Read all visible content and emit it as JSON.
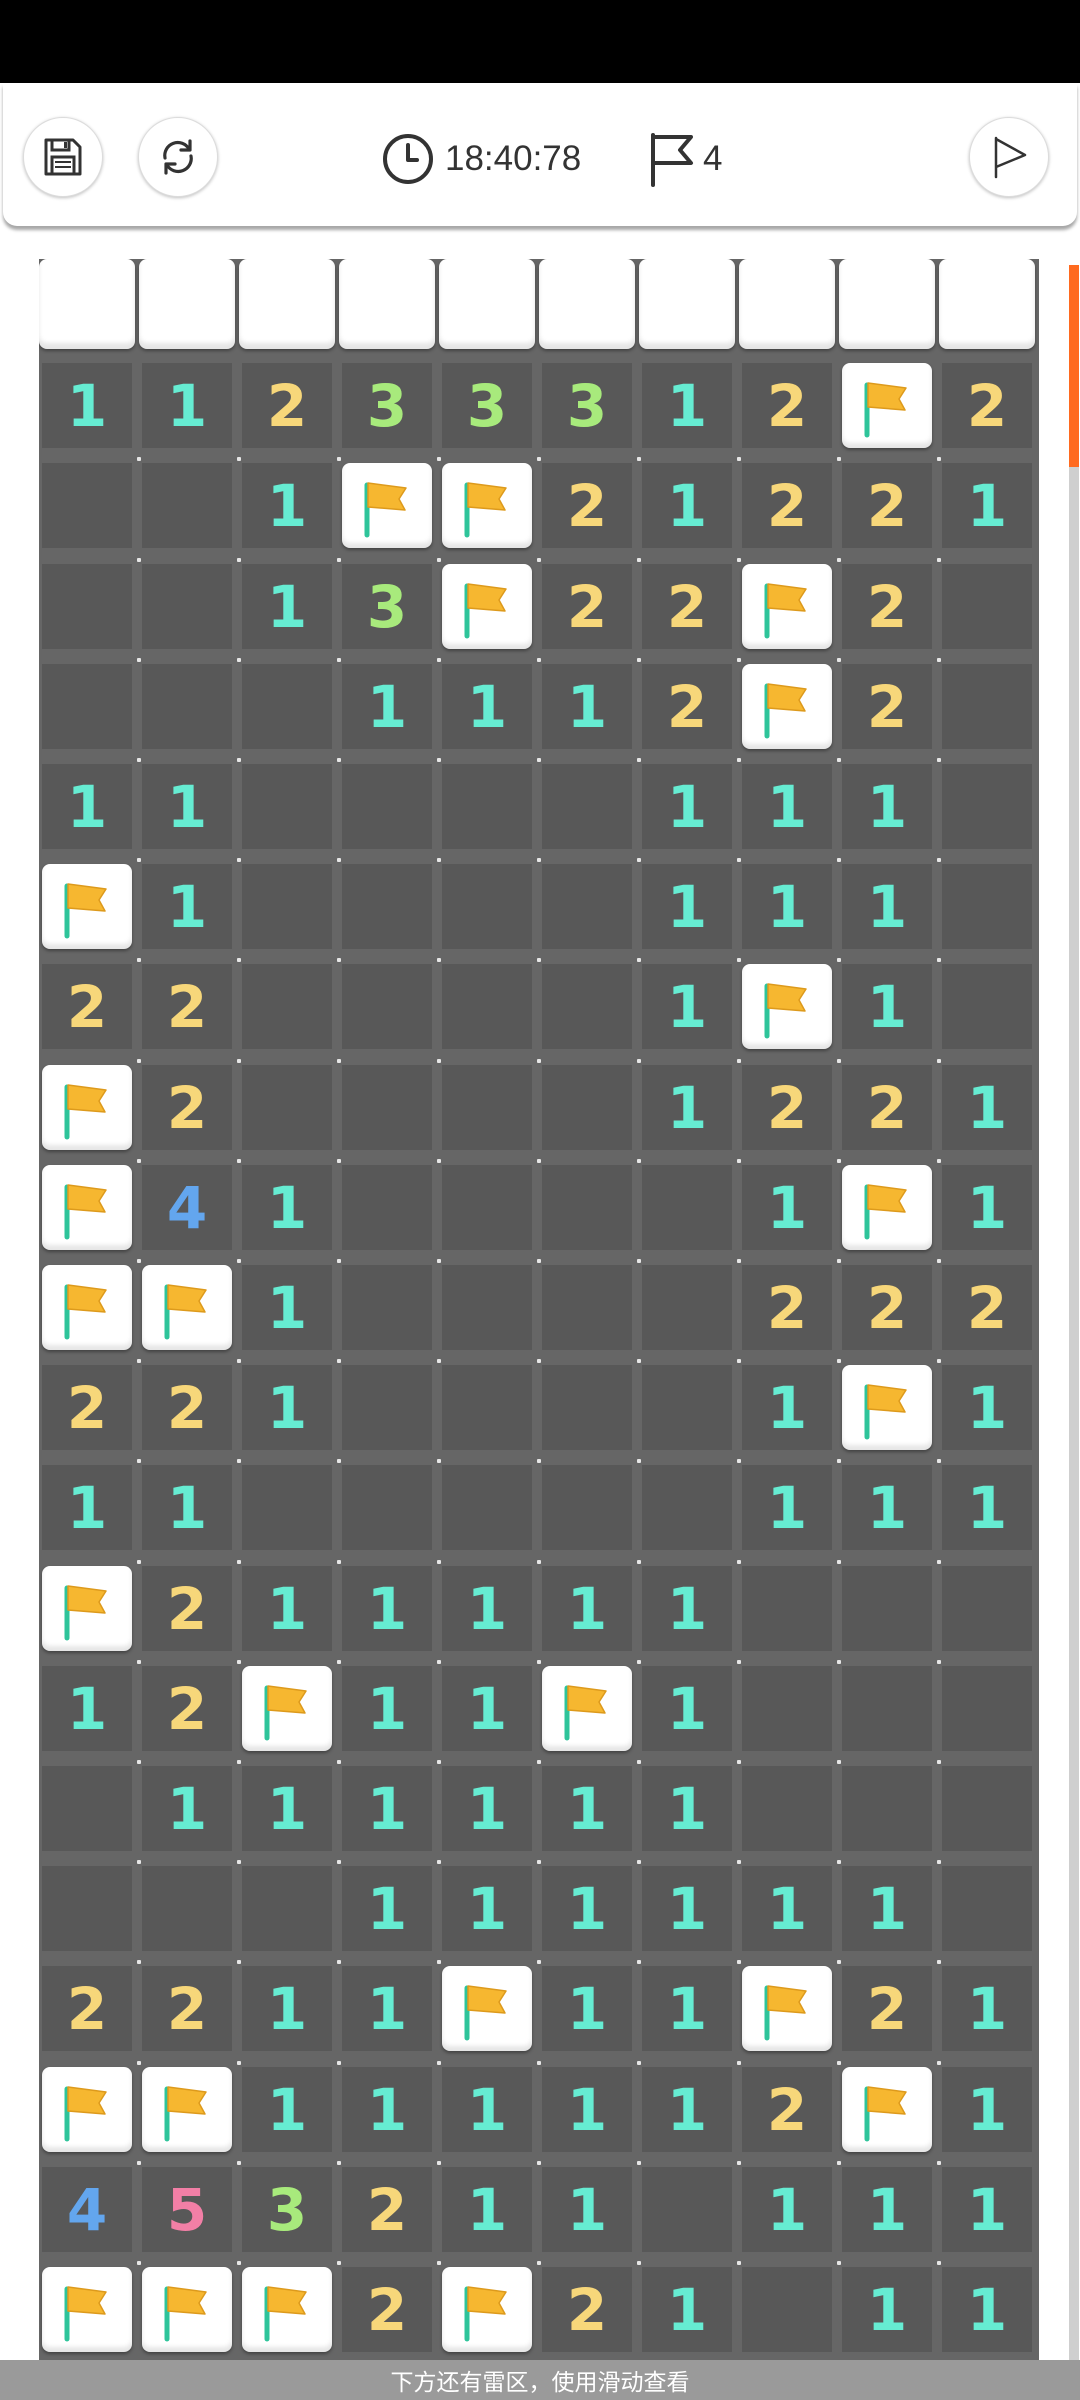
{
  "toolbar": {
    "save_icon": "save-icon",
    "refresh_icon": "refresh-icon",
    "timer": "18:40:78",
    "flags_count": "4",
    "flag_icon": "flag-icon",
    "flag_button_icon": "flag-mode-icon"
  },
  "colors": {
    "1": "#66ecd2",
    "2": "#f7d77a",
    "3": "#a8ea7c",
    "4": "#63a6ee",
    "5": "#f27fa6",
    "flag": "#f6b730",
    "flag_pole": "#2ec49a",
    "scroll_accent": "#ff6a1f"
  },
  "board": {
    "hidden_top_count": 10,
    "rows": [
      [
        "1",
        "1",
        "2",
        "3",
        "3",
        "3",
        "1",
        "2",
        "F",
        "2"
      ],
      [
        "0",
        "0",
        "1",
        "F",
        "F",
        "2",
        "1",
        "2",
        "2",
        "1"
      ],
      [
        "0",
        "0",
        "1",
        "3",
        "F",
        "2",
        "2",
        "F",
        "2",
        "0"
      ],
      [
        "0",
        "0",
        "0",
        "1",
        "1",
        "1",
        "2",
        "F",
        "2",
        "0"
      ],
      [
        "1",
        "1",
        "0",
        "0",
        "0",
        "0",
        "1",
        "1",
        "1",
        "0"
      ],
      [
        "F",
        "1",
        "0",
        "0",
        "0",
        "0",
        "1",
        "1",
        "1",
        "0"
      ],
      [
        "2",
        "2",
        "0",
        "0",
        "0",
        "0",
        "1",
        "F",
        "1",
        "0"
      ],
      [
        "F",
        "2",
        "0",
        "0",
        "0",
        "0",
        "1",
        "2",
        "2",
        "1"
      ],
      [
        "F",
        "4",
        "1",
        "0",
        "0",
        "0",
        "0",
        "1",
        "F",
        "1"
      ],
      [
        "F",
        "F",
        "1",
        "0",
        "0",
        "0",
        "0",
        "2",
        "2",
        "2"
      ],
      [
        "2",
        "2",
        "1",
        "0",
        "0",
        "0",
        "0",
        "1",
        "F",
        "1"
      ],
      [
        "1",
        "1",
        "0",
        "0",
        "0",
        "0",
        "0",
        "1",
        "1",
        "1"
      ],
      [
        "F",
        "2",
        "1",
        "1",
        "1",
        "1",
        "1",
        "0",
        "0",
        "0"
      ],
      [
        "1",
        "2",
        "F",
        "1",
        "1",
        "F",
        "1",
        "0",
        "0",
        "0"
      ],
      [
        "0",
        "1",
        "1",
        "1",
        "1",
        "1",
        "1",
        "0",
        "0",
        "0"
      ],
      [
        "0",
        "0",
        "0",
        "1",
        "1",
        "1",
        "1",
        "1",
        "1",
        "0"
      ],
      [
        "2",
        "2",
        "1",
        "1",
        "F",
        "1",
        "1",
        "F",
        "2",
        "1"
      ],
      [
        "F",
        "F",
        "1",
        "1",
        "1",
        "1",
        "1",
        "2",
        "F",
        "1"
      ],
      [
        "4",
        "5",
        "3",
        "2",
        "1",
        "1",
        "0",
        "1",
        "1",
        "1"
      ],
      [
        "F",
        "F",
        "F",
        "2",
        "F",
        "2",
        "1",
        "0",
        "1",
        "1"
      ]
    ]
  },
  "hint_text": "下方还有雷区，使用滑动查看"
}
